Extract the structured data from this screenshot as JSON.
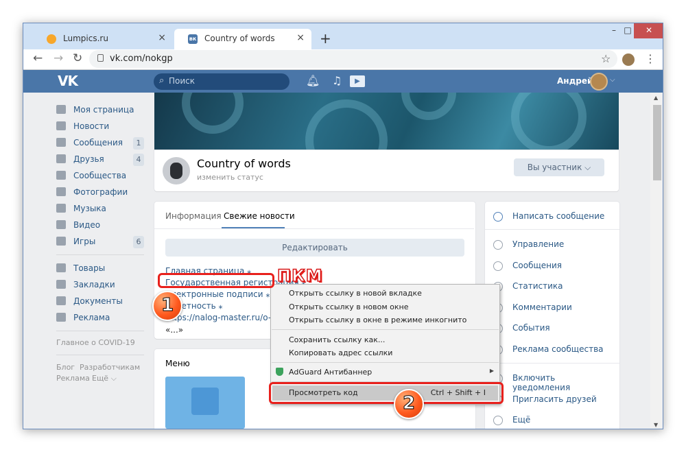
{
  "browser": {
    "tabs": [
      {
        "title": "Lumpics.ru",
        "close": "×"
      },
      {
        "title": "Country of words",
        "close": "×"
      }
    ],
    "new_tab": "+",
    "url": "vk.com/nokgp",
    "window_controls": [
      "–",
      "□",
      "✕"
    ]
  },
  "vk_header": {
    "logo": "VK",
    "search_placeholder": "Поиск",
    "user_name": "Андрей"
  },
  "sidebar": {
    "items": [
      {
        "label": "Моя страница",
        "icon": "home-icon"
      },
      {
        "label": "Новости",
        "icon": "news-icon"
      },
      {
        "label": "Сообщения",
        "icon": "messages-icon",
        "count": "1"
      },
      {
        "label": "Друзья",
        "icon": "friends-icon",
        "count": "4"
      },
      {
        "label": "Сообщества",
        "icon": "communities-icon"
      },
      {
        "label": "Фотографии",
        "icon": "photos-icon"
      },
      {
        "label": "Музыка",
        "icon": "music-icon"
      },
      {
        "label": "Видео",
        "icon": "video-icon"
      },
      {
        "label": "Игры",
        "icon": "games-icon",
        "count": "6"
      }
    ],
    "items2": [
      {
        "label": "Товары",
        "icon": "goods-icon"
      },
      {
        "label": "Закладки",
        "icon": "bookmarks-icon"
      },
      {
        "label": "Документы",
        "icon": "documents-icon"
      },
      {
        "label": "Реклама",
        "icon": "ads-icon"
      }
    ],
    "covid": "Главное о COVID-19",
    "footer": [
      "Блог",
      "Разработчикам",
      "Реклама",
      "Ещё ⌵"
    ]
  },
  "group": {
    "name": "Country of words",
    "status": "изменить статус",
    "member_button": "Вы участник ⌵"
  },
  "wiki": {
    "tabs": [
      "Информация",
      "Свежие новости"
    ],
    "edit_button": "Редактировать",
    "links": [
      "Главная страница ⁎",
      "Государственная регистрация ⁎",
      "Электронные подписи ⁎",
      "Отчетность ⁎",
      "https://nalog-master.ru/o-nas/",
      "«...»"
    ]
  },
  "menu_block": {
    "title": "Меню"
  },
  "right_nav": {
    "primary": "Написать сообщение",
    "items": [
      "Управление",
      "Сообщения",
      "Статистика",
      "Комментарии",
      "События",
      "Реклама сообщества"
    ],
    "items2": [
      "Включить уведомления",
      "Пригласить друзей",
      "Ещё"
    ]
  },
  "context_menu": {
    "items": [
      "Открыть ссылку в новой вкладке",
      "Открыть ссылку в новом окне",
      "Открыть ссылку в окне в режиме инкогнито",
      "Сохранить ссылку как...",
      "Копировать адрес ссылки",
      "AdGuard Антибаннер",
      "Просмотреть код"
    ],
    "shortcut": "Ctrl + Shift + I"
  },
  "annotations": {
    "pkm": "ПКМ",
    "step1": "1",
    "step2": "2"
  }
}
